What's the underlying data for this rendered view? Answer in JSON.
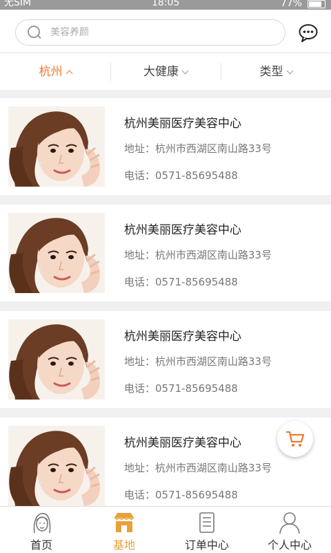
{
  "status_bar": {
    "carrier": "无SIM",
    "time": "18:05",
    "battery": "77%"
  },
  "search": {
    "placeholder": "美容养颜"
  },
  "icons": {
    "search": "search-icon",
    "message": "chat-bubble-icon",
    "cart": "cart-icon"
  },
  "filters": [
    {
      "label": "杭州"
    },
    {
      "label": "大健康"
    },
    {
      "label": "类型"
    }
  ],
  "clinics": [
    {
      "name": "杭州美丽医疗美容中心",
      "address": "地址：杭州市西湖区南山路33号",
      "phone": "电话：0571-85695488"
    },
    {
      "name": "杭州美丽医疗美容中心",
      "address": "地址：杭州市西湖区南山路33号",
      "phone": "电话：0571-85695488"
    },
    {
      "name": "杭州美丽医疗美容中心",
      "address": "地址：杭州市西湖区南山路33号",
      "phone": "电话：0571-85695488"
    },
    {
      "name": "杭州美丽医疗美容中心",
      "address": "地址：杭州市西湖区南山路33号",
      "phone": "电话：0571-85695488"
    }
  ],
  "tabs": [
    {
      "label": "首页",
      "icon": "home-face-icon"
    },
    {
      "label": "基地",
      "icon": "shop-icon"
    },
    {
      "label": "订单中心",
      "icon": "order-list-icon"
    },
    {
      "label": "个人中心",
      "icon": "person-icon"
    }
  ],
  "colors": {
    "accent": "#f07a2a",
    "tab_active": "#e8a13a"
  }
}
